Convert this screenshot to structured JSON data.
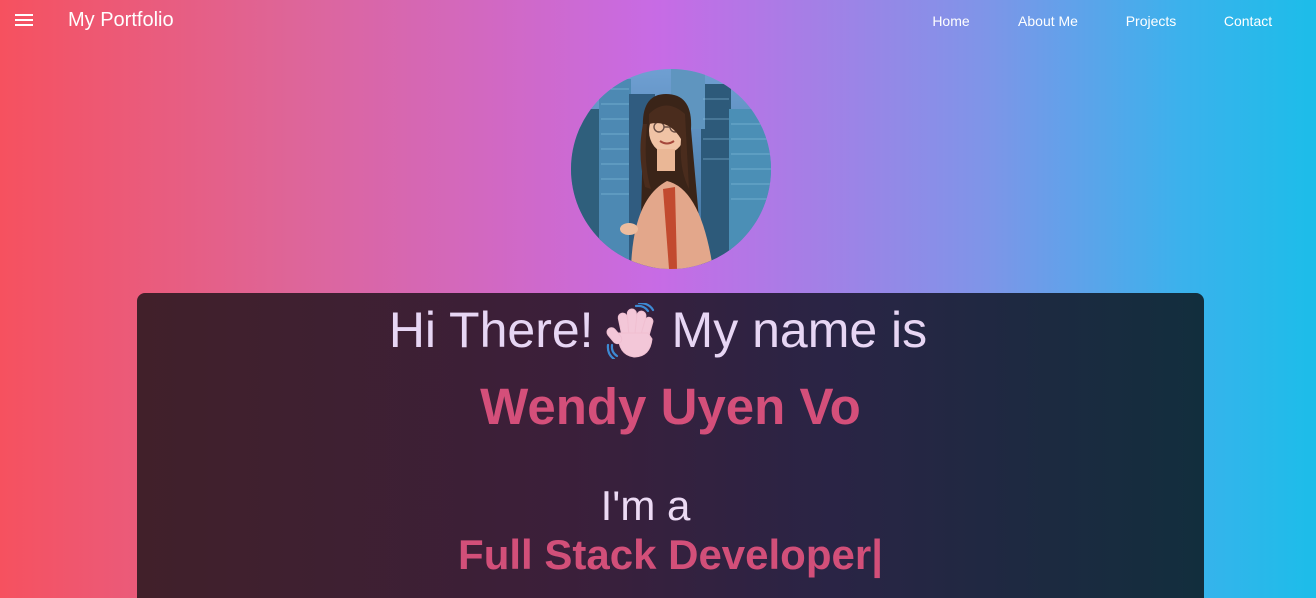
{
  "navbar": {
    "menu_icon": "hamburger-menu-icon",
    "brand": "My Portfolio",
    "links": [
      "Home",
      "About Me",
      "Projects",
      "Contact"
    ]
  },
  "hero": {
    "avatar": "profile-photo",
    "greeting_before": "Hi There!",
    "wave_icon": "waving-hand-icon",
    "greeting_after": "My name is",
    "name": "Wendy Uyen Vo",
    "intro": "I'm a",
    "role": "Full Stack Developer|"
  },
  "colors": {
    "accent_pink": "#d44f7a",
    "text_light": "#e7d6f4",
    "card_dark": "#2a2445"
  }
}
